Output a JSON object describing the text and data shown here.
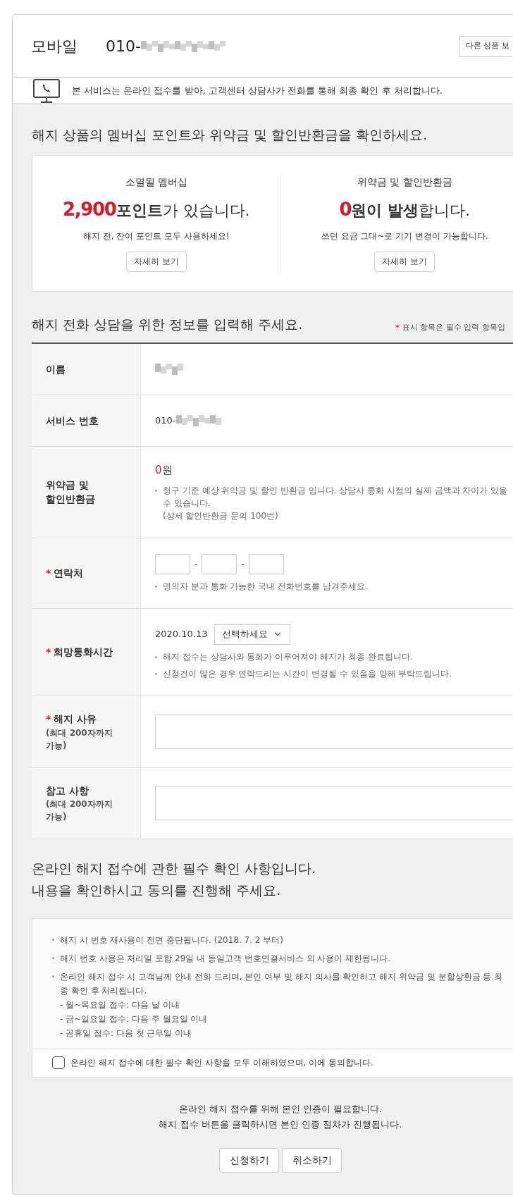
{
  "account": {
    "type": "모바일",
    "number": "010-",
    "other_button": "다른 상품 보"
  },
  "notice": "본 서비스는 온라인 접수를 받아, 고객센터 상담사가 전화를 통해 최종 확인 후 처리합니다.",
  "summary": {
    "title": "해지 상품의 멤버십 포인트와 위약금 및 할인반환금을 확인하세요.",
    "cards": [
      {
        "label": "소멸될 멤버십",
        "amount": "2,900",
        "unit": "포인트",
        "rest": "가 있습니다.",
        "note": "해지 전, 잔여 포인트 모두 사용하세요!",
        "button": "자세히 보기"
      },
      {
        "label": "위약금 및 할인반환금",
        "amount": "0",
        "unit": "원이 발생",
        "rest": "합니다.",
        "note": "쓰던 요금 그대~로 기기 변경이 가능합니다.",
        "button": "자세히 보기"
      }
    ]
  },
  "form": {
    "title": "해지 전화 상담을 위한 정보를 입력해 주세요.",
    "required_mark": "*",
    "required_note": "표시 항목은 필수 입력 항목입",
    "rows": [
      {
        "kind": "masked",
        "label": "이름"
      },
      {
        "kind": "masked",
        "label": "서비스 번호",
        "prefix": "010-"
      },
      {
        "kind": "amount",
        "label": "위약금 및\n할인반환금",
        "amount": "0",
        "unit": "원",
        "notes": [
          "청구 기준 예상 위약금 및 할인 반환금 입니다. 상담사 통화 시점의 실제 금액과 차이가 있을 수 있습니다.\n(상세 할인반환금 문의 100번)"
        ]
      },
      {
        "kind": "phone",
        "label": "연락처",
        "required_mark": "*",
        "separators": [
          "-",
          "-"
        ],
        "notes": [
          "명의자 분과 통화 가능한 국내 전화번호를 남겨주세요."
        ]
      },
      {
        "kind": "schedule",
        "label": "희망통화시간",
        "required_mark": "*",
        "date": "2020.10.13",
        "select": "선택하세요",
        "notes": [
          "해지 접수는 상담사와 통화가 이루어져야 해지가 최종 완료됩니다.",
          "신청건이 많은 경우 연락드리는 시간이 변경될 수 있음을 양해 부탁드립니다."
        ]
      },
      {
        "kind": "textarea",
        "label": "해지 사유",
        "required_mark": "*",
        "sublabel": "(최대 200자까지\n가능)"
      },
      {
        "kind": "textarea",
        "label": "참고 사항",
        "sublabel": "(최대 200자까지\n가능)"
      }
    ]
  },
  "agreement": {
    "title_lines": [
      "온라인 해지 접수에 관한 필수 확인 사항입니다.",
      "내용을 확인하시고 동의를 진행해 주세요."
    ],
    "items": [
      {
        "text": "해지 시 번호 재사용이 전면 중단됩니다. (2018. 7. 2 부터)"
      },
      {
        "text": "해지 번호 사용은 처리일 포함 29일 내 동일고객 번호연결서비스 외 사용이 제한됩니다."
      },
      {
        "text": "온라인 해지 접수 시 고객님께 안내 전화 드리며, 본인 여부 및 해지 의사를 확인하고 해지 위약금 및 분할상환금 등 최종 확인 후 처리됩니다.",
        "sub": [
          "- 월~목요일 접수: 다음 날 이내",
          "- 금~일요일 접수: 다음 주 월요일 이내",
          "- 공휴일 접수: 다음 첫 근무일 이내"
        ]
      }
    ],
    "checkbox": {
      "label": "온라인 해지 접수에 대한 필수 확인 사항을 모두 이해하였으며, 이에 동의합니다.",
      "checked": false
    }
  },
  "footer": {
    "lines": [
      "온라인 해지 접수를 위해 본인 인증이 필요합니다.",
      "해지 접수 버튼을 클릭하시면 본인 인증 절차가 진행됩니다."
    ],
    "buttons": [
      "신청하기",
      "취소하기"
    ]
  }
}
